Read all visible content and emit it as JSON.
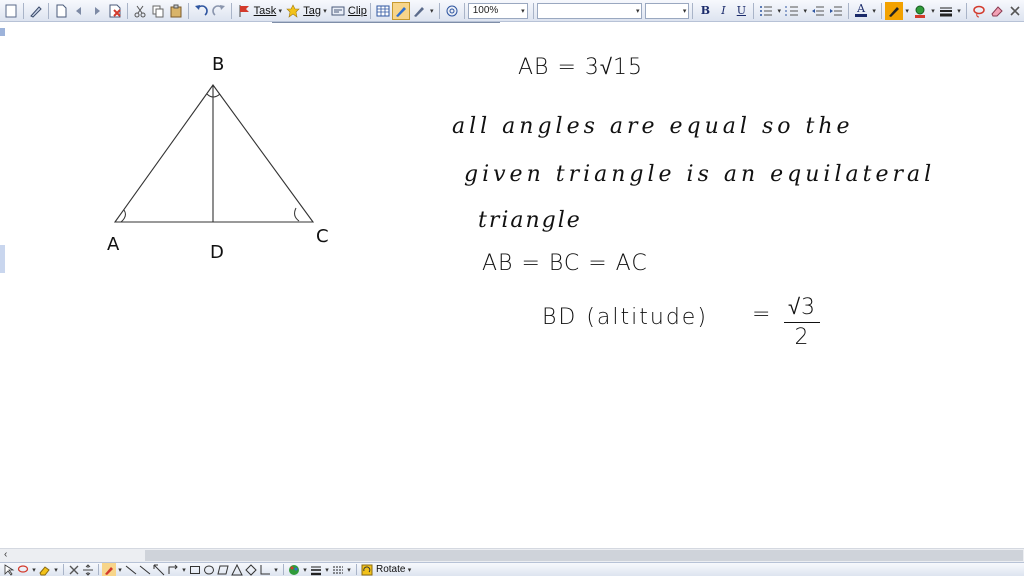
{
  "toolbar": {
    "task_label": "Task",
    "tag_label": "Tag",
    "clip_label": "Clip",
    "zoom_value": "100%",
    "font_name_value": "",
    "font_size_value": "",
    "bold_label": "B",
    "italic_label": "I",
    "underline_label": "U",
    "font_color_label": "A",
    "colors": {
      "highlight": "#f2a100",
      "accent": "#d33a2c",
      "green": "#2f9b3a"
    }
  },
  "canvas": {
    "diagram": {
      "vertex_labels": {
        "a": "A",
        "b": "B",
        "c": "C",
        "d": "D"
      }
    },
    "notes": {
      "ab_value": "AB = 3√15",
      "line1": "all angles are equal so the",
      "line2": "given triangle is an equilateral",
      "line3": "triangle",
      "line4": "AB = BC = AC",
      "bd_label": "BD (altitude)",
      "equals": "=",
      "frac_num": "√3",
      "frac_den": "2"
    }
  },
  "bottom_toolbar": {
    "rotate_label": "Rotate"
  },
  "scrollbar": {
    "left_arrow": "‹"
  }
}
